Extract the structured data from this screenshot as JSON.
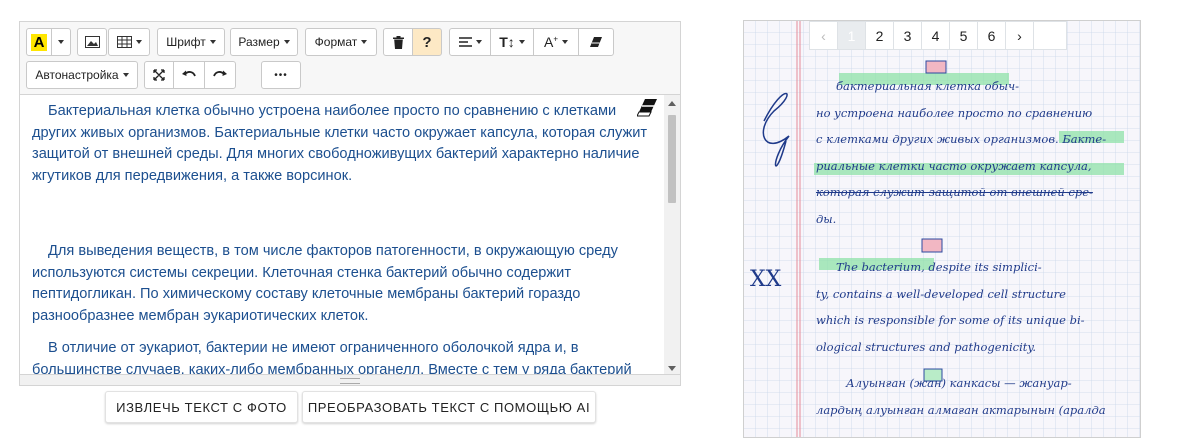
{
  "toolbar": {
    "font_label": "Шрифт",
    "size_label": "Размер",
    "format_label": "Формат",
    "help_label": "?",
    "autosetup_label": "Автонастройка",
    "more_label": "•••"
  },
  "editor": {
    "paragraphs": [
      "Бактериальная клетка обычно устроена наиболее просто по сравнению с клетками других живых организмов. Бактериальные клетки часто окружает капсула, которая служит защитой от внешней среды. Для многих свободноживущих бактерий характерно наличие жгутиков для передвижения, а также ворсинок.",
      "Для выведения веществ, в том числе факторов патогенности, в окружающую среду используются системы секреции. Клеточная стенка бактерий обычно содержит пептидогликан. По химическому составу клеточные мембраны бактерий гораздо разнообразнее мембран эукариотических клеток.",
      "В отличие от эукариот, бактерии не имеют ограниченного оболочкой ядра и, в большинстве случаев, каких-либо мембранных органелл. Вместе с тем у ряда бактерий"
    ]
  },
  "actions": {
    "extract_label": "ИЗВЛЕЧЬ ТЕКСТ С ФОТО",
    "transform_label": "ПРЕОБРАЗОВАТЬ ТЕКСТ С ПОМОЩЬЮ AI"
  },
  "pager": {
    "prev": "‹",
    "pages": [
      "1",
      "2",
      "3",
      "4",
      "5",
      "6"
    ],
    "next": "›",
    "active_page": 1
  },
  "notebook": {
    "lines": [
      "бактериальная клетка обыч-",
      "но устроена наиболее просто по сравнению",
      "с клетками других живых организмов. Бакте-",
      "риальные клетки часто окружает капсула,",
      "которая служит защитой от внешней сре-",
      "ды.",
      "The bacterium, despite its simplici-",
      "ty, contains a well-developed cell structure",
      "which is responsible for some of its unique bi-",
      "ological structures and pathogenicity.",
      "Алуынған (жан) канкасы — жануар-",
      "лардың алуынған алмаған актарынын (аралда"
    ],
    "colors": {
      "ink": "#1f3a8a",
      "highlight": "#7ee0a0",
      "grid": "#c8d4e8",
      "margin": "#e07a8a"
    }
  }
}
